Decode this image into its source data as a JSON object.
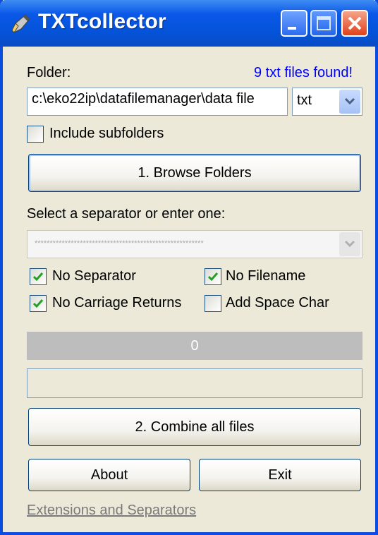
{
  "window": {
    "title": "TXTcollector"
  },
  "folder": {
    "label": "Folder:",
    "status": "9 txt files found!",
    "path": "c:\\eko22ip\\datafilemanager\\data file",
    "extension": "txt"
  },
  "options": {
    "include_subfolders": {
      "label": "Include subfolders",
      "checked": false
    },
    "no_separator": {
      "label": "No Separator",
      "checked": true
    },
    "no_filename": {
      "label": "No Filename",
      "checked": true
    },
    "no_carriage_returns": {
      "label": "No Carriage Returns",
      "checked": true
    },
    "add_space_char": {
      "label": "Add Space Char",
      "checked": false
    }
  },
  "buttons": {
    "browse": "1. Browse Folders",
    "combine": "2. Combine all files",
    "about": "About",
    "exit": "Exit"
  },
  "separator": {
    "label": "Select a separator or enter one:",
    "value": "********************************************************"
  },
  "progress": {
    "value": "0"
  },
  "footer": {
    "link": "Extensions and Separators"
  },
  "colors": {
    "titlebar": "#0a58e8",
    "status_text": "#0000ff",
    "window_bg": "#ece9d8"
  },
  "icons": [
    "pen-icon",
    "minimize-icon",
    "maximize-icon",
    "close-icon",
    "chevron-down-icon",
    "checkmark-icon"
  ]
}
